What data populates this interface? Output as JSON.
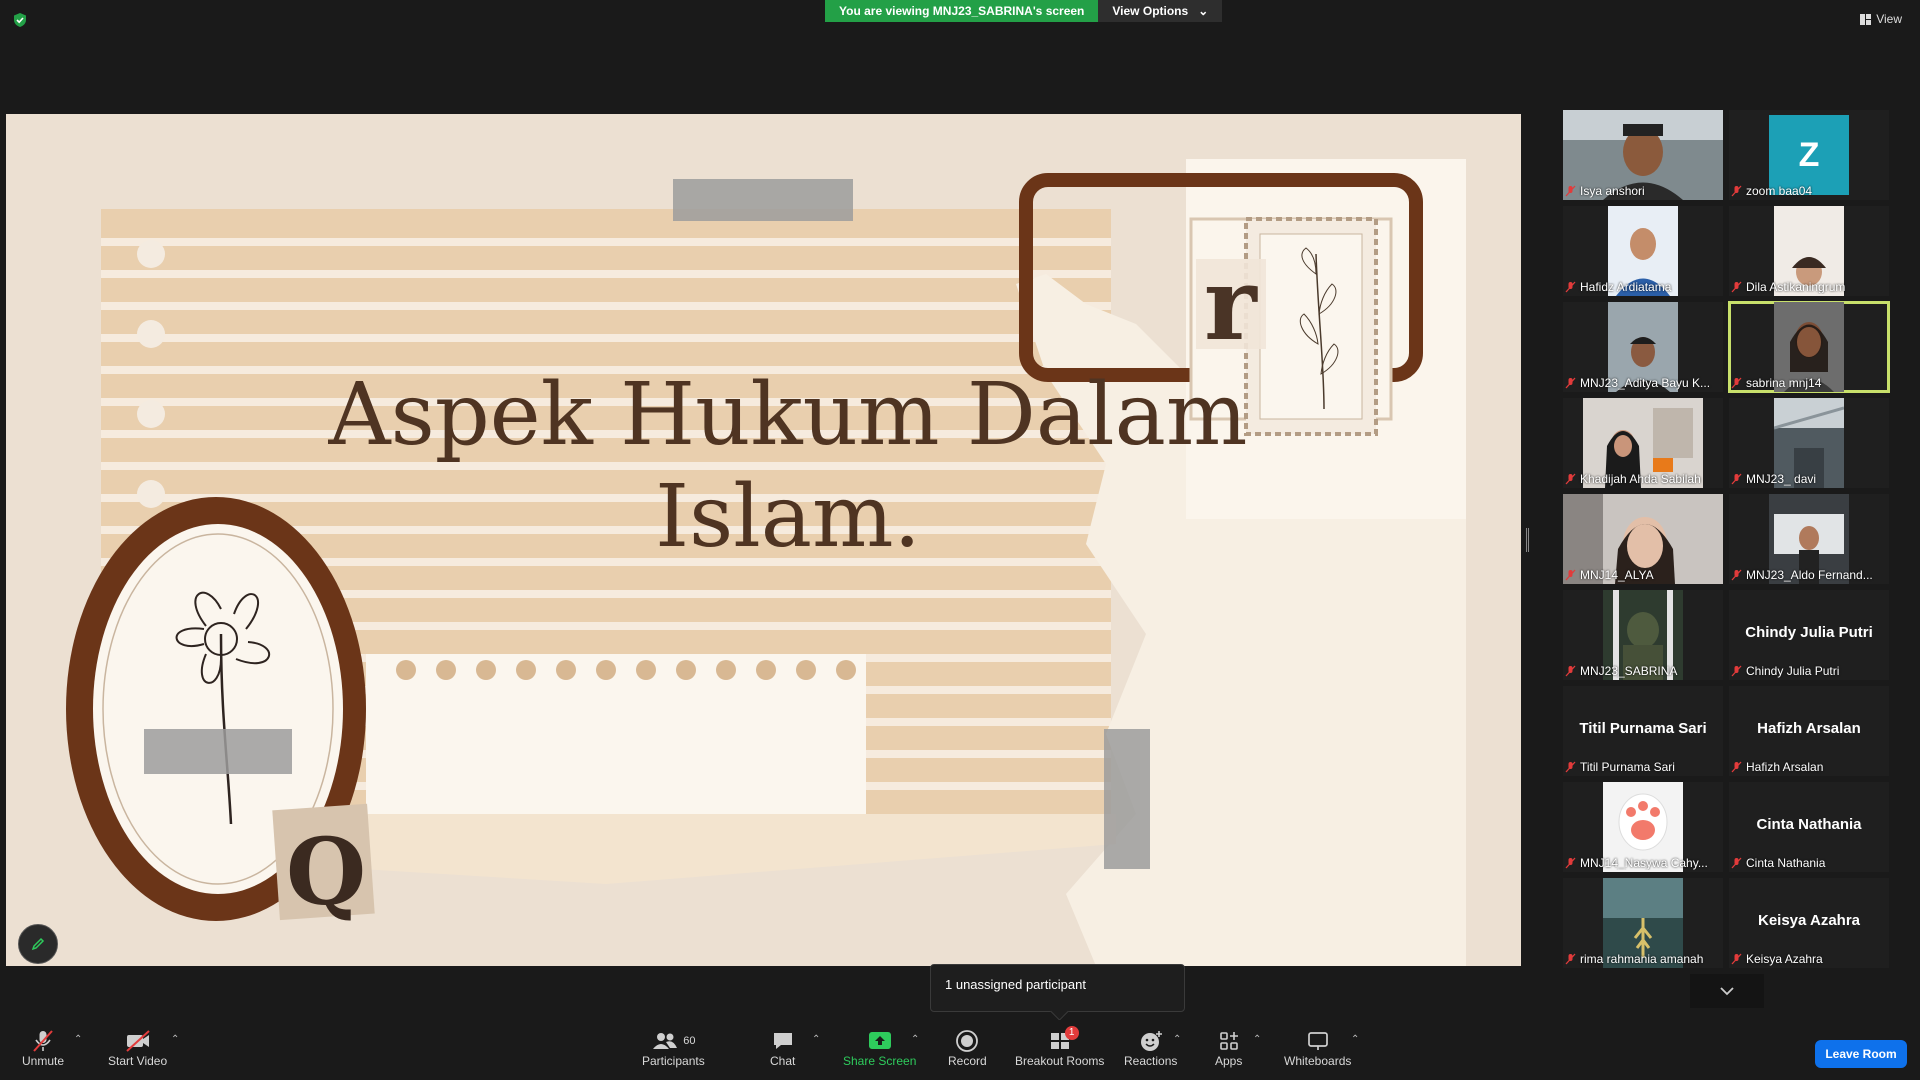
{
  "banner": {
    "viewing_text": "You are viewing MNJ23_SABRINA's screen",
    "view_options": "View Options"
  },
  "top_right": {
    "view_label": "View"
  },
  "slide": {
    "title_line1": "Aspek Hukum Dalam",
    "title_line2": "Islam.",
    "letter_r": "r",
    "letter_q": "Q"
  },
  "participants": [
    {
      "display": "video",
      "name": "Isya anshori"
    },
    {
      "display": "avatar",
      "avatar_letter": "Z",
      "name": "zoom baa04"
    },
    {
      "display": "video",
      "name": "Hafidz Ardiatama"
    },
    {
      "display": "video",
      "name": "Dila Astikaningrum"
    },
    {
      "display": "video",
      "name": "MNJ23_Aditya Bayu K..."
    },
    {
      "display": "video",
      "name": "sabrina mnj14",
      "active_speaker": true
    },
    {
      "display": "video",
      "name": "Khadijah Ahda Sabilah"
    },
    {
      "display": "video",
      "name": "MNJ23_ davi"
    },
    {
      "display": "video",
      "name": "MNJ14_ALYA"
    },
    {
      "display": "video",
      "name": "MNJ23_Aldo Fernand..."
    },
    {
      "display": "video",
      "name": "MNJ23_SABRINA"
    },
    {
      "display": "name",
      "big_name": "Chindy Julia Putri",
      "name": "Chindy Julia Putri"
    },
    {
      "display": "name",
      "big_name": "Titil Purnama Sari",
      "name": "Titil Purnama Sari"
    },
    {
      "display": "name",
      "big_name": "Hafizh Arsalan",
      "name": "Hafizh Arsalan"
    },
    {
      "display": "video",
      "name": "MNJ14_Nasywa Cahy..."
    },
    {
      "display": "name",
      "big_name": "Cinta Nathania",
      "name": "Cinta Nathania"
    },
    {
      "display": "video",
      "name": "rima rahmania amanah"
    },
    {
      "display": "name",
      "big_name": "Keisya Azahra",
      "name": "Keisya Azahra"
    }
  ],
  "tooltip": {
    "text": "1 unassigned participant"
  },
  "toolbar": {
    "unmute": "Unmute",
    "start_video": "Start Video",
    "participants": "Participants",
    "participants_count": "60",
    "chat": "Chat",
    "share_screen": "Share Screen",
    "record": "Record",
    "breakout_rooms": "Breakout Rooms",
    "breakout_badge": "1",
    "reactions": "Reactions",
    "apps": "Apps",
    "whiteboards": "Whiteboards",
    "leave_room": "Leave Room"
  },
  "colors": {
    "accent_green": "#23a047",
    "leave_blue": "#0e71eb",
    "active_outline": "#c8e06b",
    "avatar_teal": "#1ca0b6"
  }
}
